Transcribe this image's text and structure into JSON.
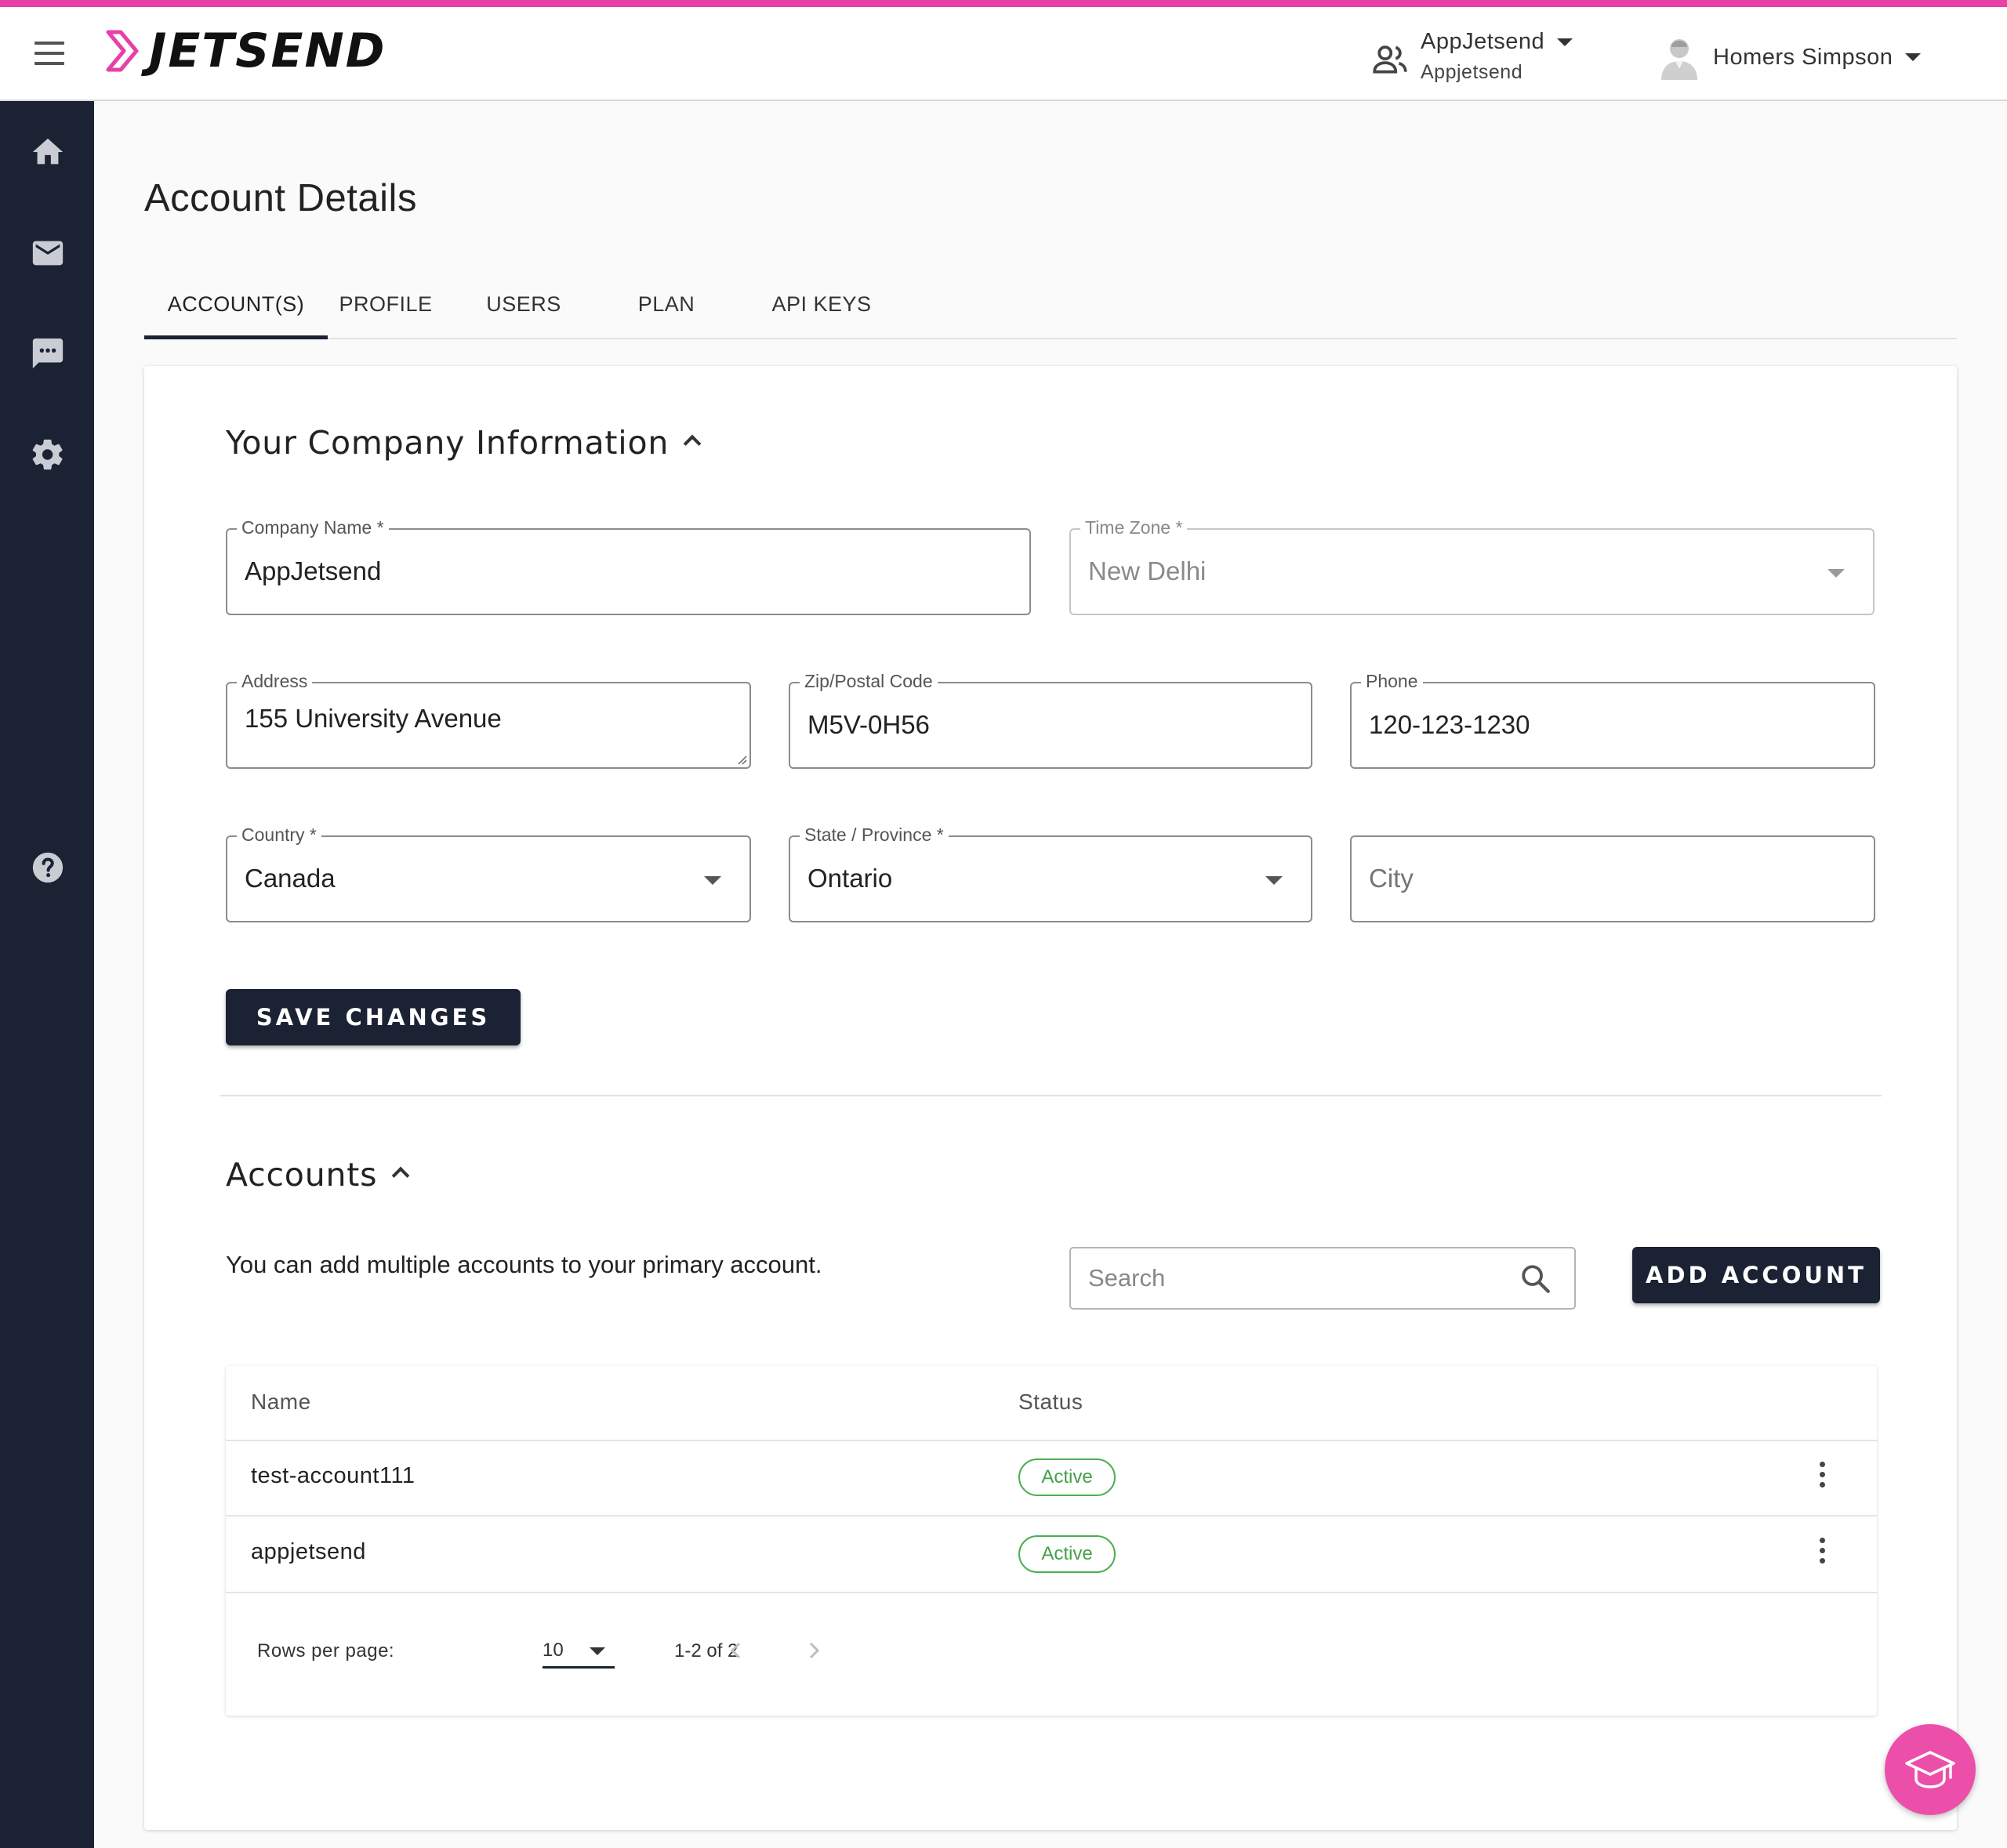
{
  "brand": {
    "logo_text": "JETSEND",
    "accent_color": "#e83fa8",
    "dark_color": "#1b2233"
  },
  "header": {
    "org_name": "AppJetsend",
    "org_sub": "Appjetsend",
    "user_name": "Homers Simpson"
  },
  "sidebar": {
    "items": [
      {
        "icon": "home-icon"
      },
      {
        "icon": "mail-icon"
      },
      {
        "icon": "chat-icon"
      },
      {
        "icon": "gear-icon"
      },
      {
        "icon": "help-icon"
      }
    ]
  },
  "page": {
    "title": "Account Details"
  },
  "tabs": [
    {
      "label": "ACCOUNT(S)",
      "active": true
    },
    {
      "label": "PROFILE"
    },
    {
      "label": "USERS"
    },
    {
      "label": "PLAN"
    },
    {
      "label": "API KEYS"
    }
  ],
  "company": {
    "section_title": "Your Company Information",
    "company_name": {
      "label": "Company Name *",
      "value": "AppJetsend"
    },
    "time_zone": {
      "label": "Time Zone *",
      "value": "New Delhi"
    },
    "address": {
      "label": "Address",
      "value": "155 University Avenue"
    },
    "zip": {
      "label": "Zip/Postal Code",
      "value": "M5V-0H56"
    },
    "phone": {
      "label": "Phone",
      "value": "120-123-1230"
    },
    "country": {
      "label": "Country *",
      "value": "Canada"
    },
    "state": {
      "label": "State / Province *",
      "value": "Ontario"
    },
    "city": {
      "placeholder": "City"
    },
    "save_label": "SAVE CHANGES"
  },
  "accounts": {
    "section_title": "Accounts",
    "description": "You can add multiple accounts to your primary account.",
    "search_placeholder": "Search",
    "add_label": "ADD ACCOUNT",
    "columns": {
      "name": "Name",
      "status": "Status"
    },
    "rows": [
      {
        "name": "test-account111",
        "status": "Active"
      },
      {
        "name": "appjetsend",
        "status": "Active"
      }
    ],
    "pagination": {
      "rows_per_page_label": "Rows per page:",
      "rows_per_page": "10",
      "range": "1-2 of 2"
    }
  }
}
